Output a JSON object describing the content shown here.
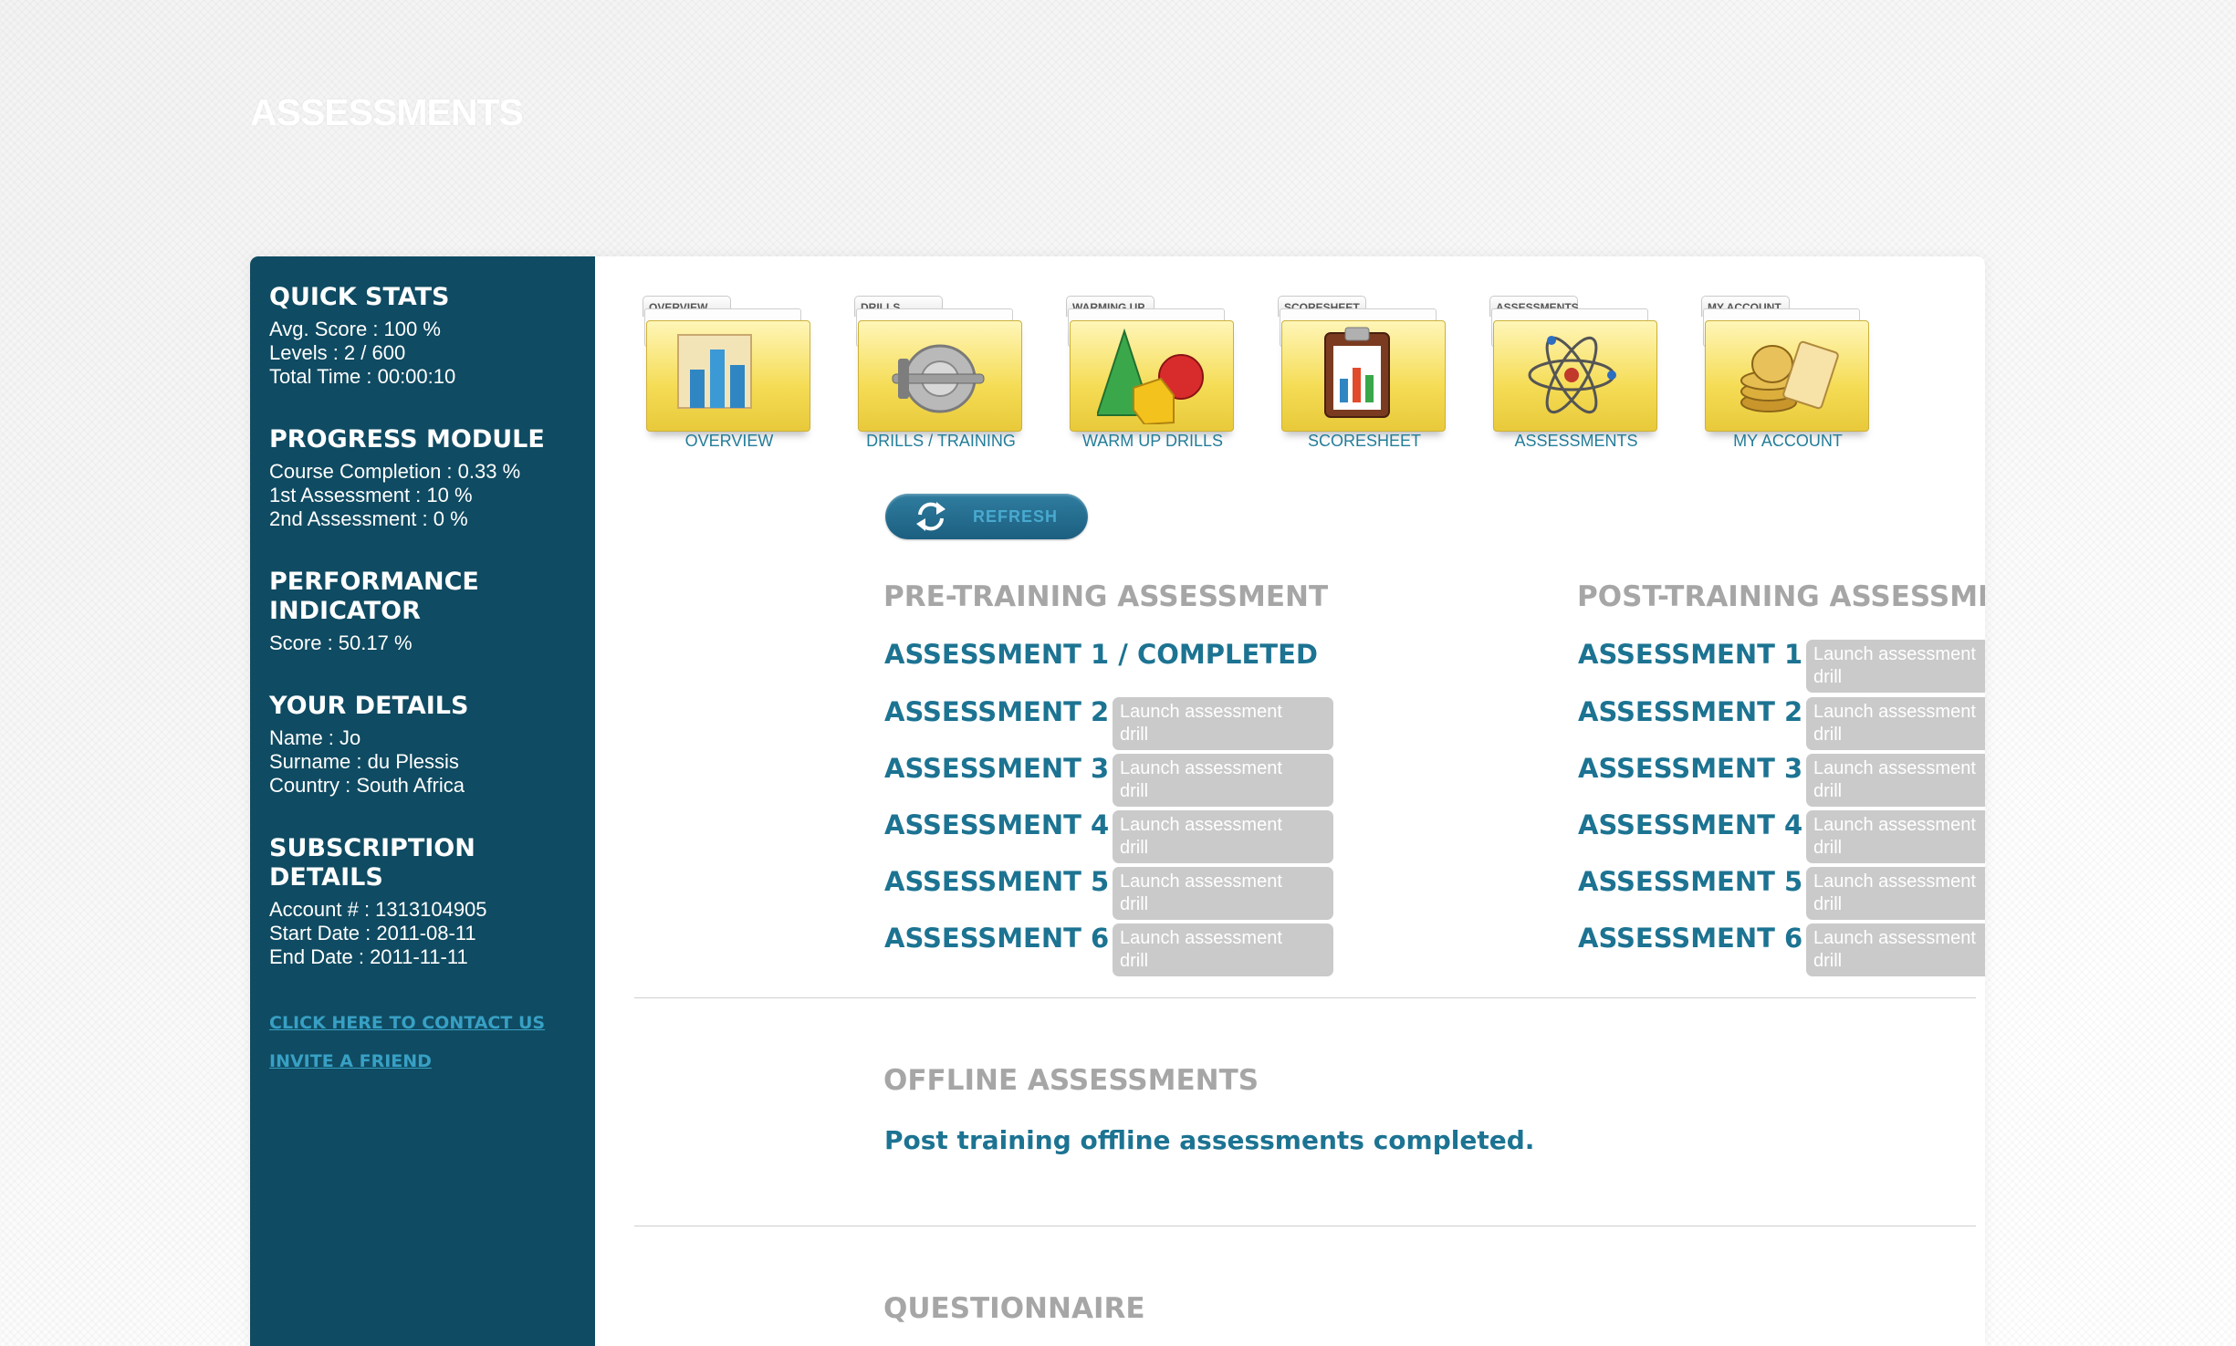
{
  "page": {
    "title": "ASSESSMENTS"
  },
  "sidebar": {
    "quick_stats": {
      "heading": "QUICK STATS",
      "lines": [
        "Avg. Score : 100 %",
        "Levels : 2 / 600",
        "Total Time : 00:00:10"
      ]
    },
    "progress_module": {
      "heading": "PROGRESS MODULE",
      "lines": [
        "Course Completion : 0.33 %",
        "1st Assessment : 10 %",
        "2nd Assessment : 0 %"
      ]
    },
    "performance_indicator": {
      "heading_line1": "PERFORMANCE",
      "heading_line2": "INDICATOR",
      "lines": [
        "Score : 50.17 %"
      ]
    },
    "your_details": {
      "heading": "YOUR DETAILS",
      "lines": [
        "Name : Jo",
        "Surname : du Plessis",
        "Country : South Africa"
      ]
    },
    "subscription_details": {
      "heading_line1": "SUBSCRIPTION",
      "heading_line2": "DETAILS",
      "lines": [
        "Account # : 1313104905",
        "Start Date : 2011-08-11",
        "End Date : 2011-11-11"
      ]
    },
    "links": {
      "contact": "CLICK HERE TO CONTACT US",
      "invite": "INVITE A FRIEND"
    }
  },
  "nav": {
    "items": [
      {
        "tab": "OVERVIEW",
        "label": "OVERVIEW",
        "icon": "bar-chart-icon"
      },
      {
        "tab": "DRILLS",
        "label": "DRILLS / TRAINING",
        "icon": "dumbbell-icon"
      },
      {
        "tab": "WARMING UP",
        "label": "WARM UP DRILLS",
        "icon": "shapes-icon"
      },
      {
        "tab": "SCORESHEET",
        "label": "SCORESHEET",
        "icon": "clipboard-icon"
      },
      {
        "tab": "ASSESSMENTS",
        "label": "ASSESSMENTS",
        "icon": "atom-icon"
      },
      {
        "tab": "MY ACCOUNT",
        "label": "MY ACCOUNT",
        "icon": "coins-icon"
      }
    ]
  },
  "toolbar": {
    "refresh_label": "REFRESH"
  },
  "pre_training": {
    "heading": "PRE-TRAINING ASSESSMENT",
    "items": [
      {
        "title": "ASSESSMENT 1 / COMPLETED"
      },
      {
        "title": "ASSESSMENT 2",
        "button_line1": "Launch assessment",
        "button_line2": "drill"
      },
      {
        "title": "ASSESSMENT 3",
        "button_line1": "Launch assessment",
        "button_line2": "drill"
      },
      {
        "title": "ASSESSMENT 4",
        "button_line1": "Launch assessment",
        "button_line2": "drill"
      },
      {
        "title": "ASSESSMENT 5",
        "button_line1": "Launch assessment",
        "button_line2": "drill"
      },
      {
        "title": "ASSESSMENT 6",
        "button_line1": "Launch assessment",
        "button_line2": "drill"
      }
    ]
  },
  "post_training": {
    "heading": "POST-TRAINING ASSESSMENT",
    "items": [
      {
        "title": "ASSESSMENT 1",
        "button_line1": "Launch assessment",
        "button_line2": "drill"
      },
      {
        "title": "ASSESSMENT 2",
        "button_line1": "Launch assessment",
        "button_line2": "drill"
      },
      {
        "title": "ASSESSMENT 3",
        "button_line1": "Launch assessment",
        "button_line2": "drill"
      },
      {
        "title": "ASSESSMENT 4",
        "button_line1": "Launch assessment",
        "button_line2": "drill"
      },
      {
        "title": "ASSESSMENT 5",
        "button_line1": "Launch assessment",
        "button_line2": "drill"
      },
      {
        "title": "ASSESSMENT 6",
        "button_line1": "Launch assessment",
        "button_line2": "drill"
      }
    ]
  },
  "offline": {
    "heading": "OFFLINE ASSESSMENTS",
    "text": "Post training offline assessments completed."
  },
  "questionnaire": {
    "heading": "QUESTIONNAIRE"
  },
  "colors": {
    "sidebar_bg": "#0f4b62",
    "accent_text": "#1c7392",
    "heading_gray": "#a6a6a6",
    "button_gray": "#cacaca",
    "link": "#38a0c4",
    "folder_yellow": "#f5dc55"
  }
}
